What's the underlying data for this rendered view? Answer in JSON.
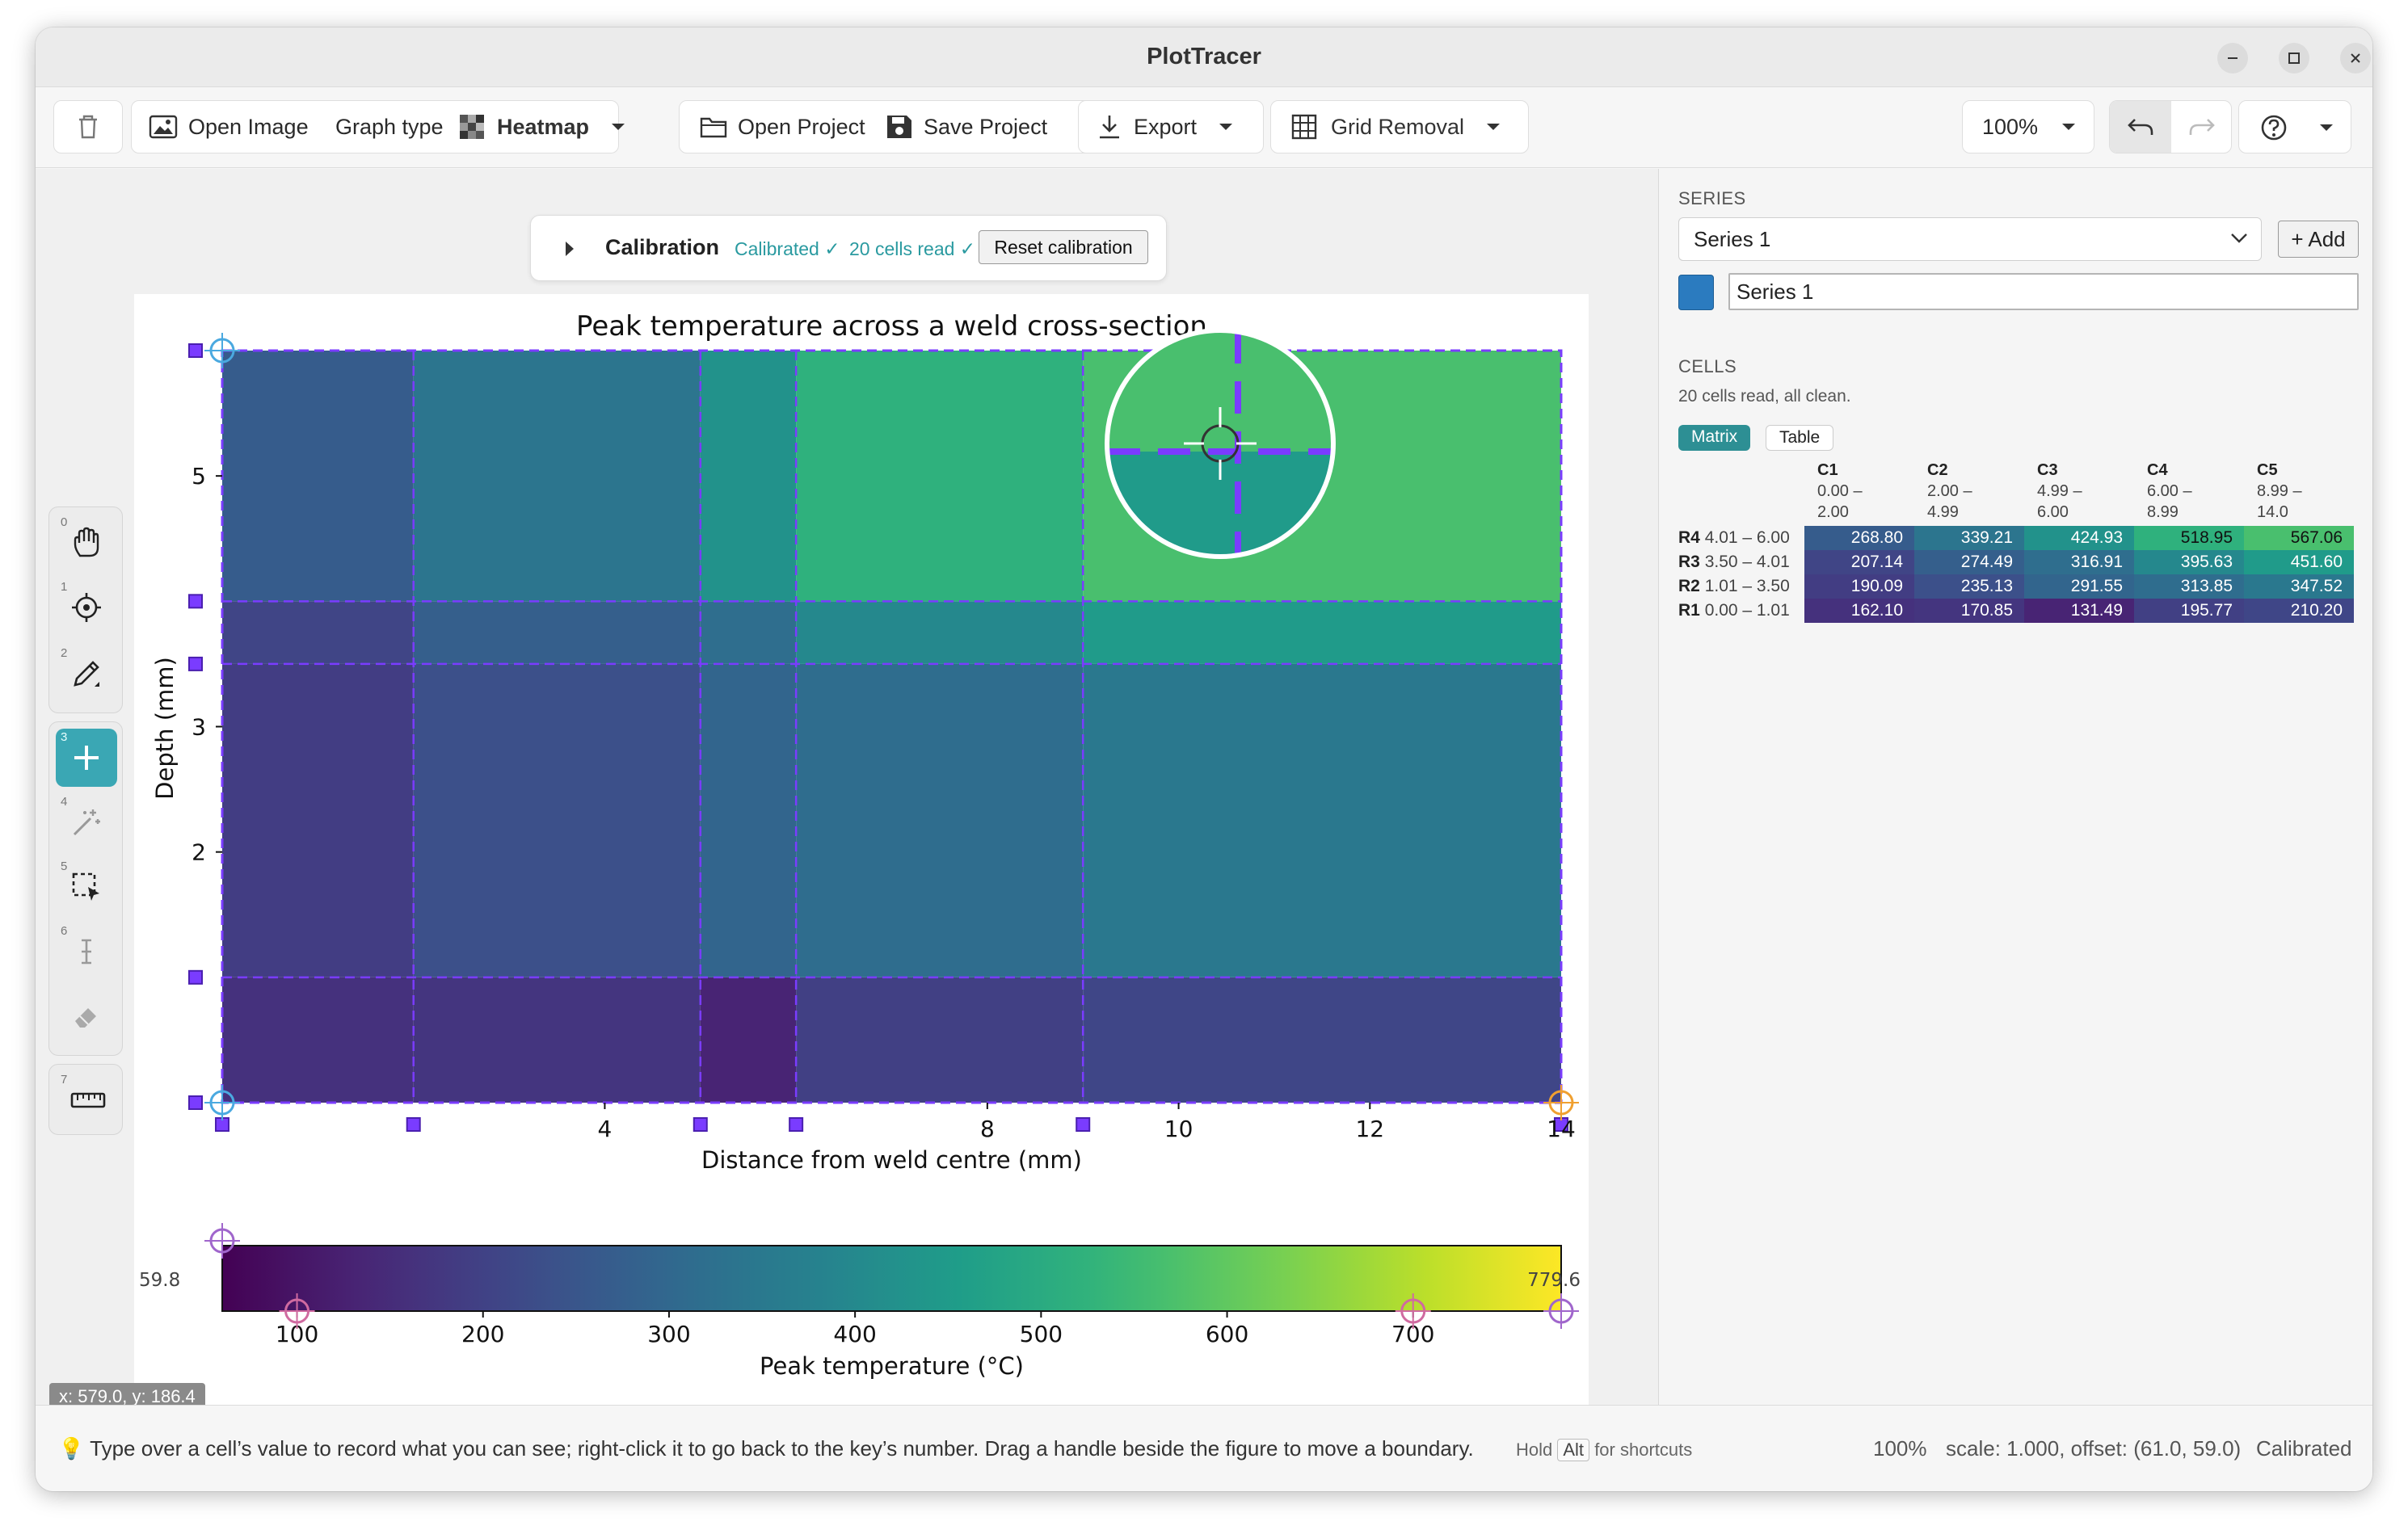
{
  "window": {
    "title": "PlotTracer"
  },
  "toolbar": {
    "open_image": "Open Image",
    "graph_type_label": "Graph type",
    "graph_type_value": "Heatmap",
    "open_project": "Open Project",
    "save_project": "Save Project",
    "export": "Export",
    "grid_removal": "Grid Removal",
    "zoom": "100%"
  },
  "calibration": {
    "title": "Calibration",
    "status": "Calibrated ✓",
    "cells_status": "20 cells read ✓",
    "reset": "Reset calibration"
  },
  "tools": [
    "hand-icon",
    "crosshair-icon",
    "pencil-icon",
    "plus-icon",
    "magic-wand-icon",
    "select-region-icon",
    "text-cursor-icon",
    "eraser-icon",
    "ruler-icon"
  ],
  "tool_numbers": [
    "0",
    "1",
    "2",
    "3",
    "4",
    "5",
    "6",
    "",
    "7"
  ],
  "coords": "x: 579.0, y: 186.4",
  "chart_data": {
    "type": "heatmap",
    "title": "Peak temperature across a weld cross-section",
    "xlabel": "Distance from weld centre (mm)",
    "ylabel": "Depth (mm)",
    "xlim": [
      0,
      14
    ],
    "ylim": [
      0,
      6
    ],
    "xticks": [
      "4",
      "8",
      "10",
      "12",
      "14"
    ],
    "yticks": [
      "2",
      "3",
      "5"
    ],
    "x_edges": [
      0,
      2,
      5,
      6,
      9,
      14
    ],
    "y_edges": [
      0,
      1,
      3.5,
      4,
      6
    ],
    "rows_bottom_to_top": [
      [
        162.1,
        170.85,
        131.49,
        195.77,
        210.2
      ],
      [
        190.09,
        235.13,
        291.55,
        313.85,
        347.52
      ],
      [
        207.14,
        274.49,
        316.91,
        395.63,
        451.6
      ],
      [
        268.8,
        339.21,
        424.93,
        518.95,
        567.06
      ]
    ],
    "colorbar": {
      "label": "Peak temperature (°C)",
      "min": 59.8,
      "max": 779.6,
      "min_label": "59.8",
      "max_label": "779.6",
      "ticks": [
        "100",
        "200",
        "300",
        "400",
        "500",
        "600",
        "700"
      ],
      "colormap": "viridis"
    }
  },
  "sidebar": {
    "series_label": "SERIES",
    "series_select": "Series 1",
    "add_button": "+ Add",
    "series_name": "Series 1",
    "series_color": "#2b7bbf",
    "cells_label": "CELLS",
    "cells_summary": "20 cells read, all clean.",
    "view_matrix": "Matrix",
    "view_table": "Table",
    "columns": [
      {
        "id": "C1",
        "range_a": "0.00 –",
        "range_b": "2.00"
      },
      {
        "id": "C2",
        "range_a": "2.00 –",
        "range_b": "4.99"
      },
      {
        "id": "C3",
        "range_a": "4.99 –",
        "range_b": "6.00"
      },
      {
        "id": "C4",
        "range_a": "6.00 –",
        "range_b": "8.99"
      },
      {
        "id": "C5",
        "range_a": "8.99 –",
        "range_b": "14.0"
      }
    ],
    "rows": [
      {
        "id": "R4",
        "range": "4.01 – 6.00",
        "values": [
          "268.80",
          "339.21",
          "424.93",
          "518.95",
          "567.06"
        ]
      },
      {
        "id": "R3",
        "range": "3.50 – 4.01",
        "values": [
          "207.14",
          "274.49",
          "316.91",
          "395.63",
          "451.60"
        ]
      },
      {
        "id": "R2",
        "range": "1.01 – 3.50",
        "values": [
          "190.09",
          "235.13",
          "291.55",
          "313.85",
          "347.52"
        ]
      },
      {
        "id": "R1",
        "range": "0.00 – 1.01",
        "values": [
          "162.10",
          "170.85",
          "131.49",
          "195.77",
          "210.20"
        ]
      }
    ]
  },
  "status": {
    "tip": "Type over a cell’s value to record what you can see; right-click it to go back to the key’s number. Drag a handle beside the figure to move a boundary.",
    "hold": "Hold",
    "alt": "Alt",
    "for_shortcuts": "for shortcuts",
    "zoom": "100%",
    "scale": "scale: 1.000, offset: (61.0, 59.0)",
    "state": "Calibrated"
  }
}
